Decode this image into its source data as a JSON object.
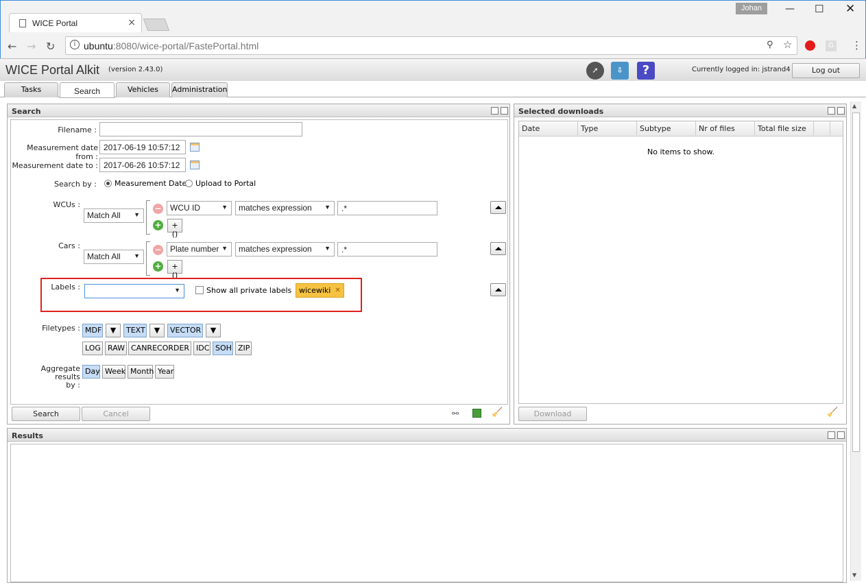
{
  "browser": {
    "tab_title": "WICE Portal",
    "user": "Johan",
    "url_host": "ubuntu",
    "url_rest": ":8080/wice-portal/FastePortal.html"
  },
  "app": {
    "title": "WICE Portal Alkit",
    "version": "(version 2.43.0)",
    "logged_in_text": "Currently logged in: jstrand4",
    "logout_label": "Log out",
    "tabs": [
      "Tasks",
      "Search",
      "Vehicles",
      "Administration"
    ],
    "selected_tab": "Search"
  },
  "search": {
    "header": "Search",
    "filename_label": "Filename :",
    "filename_value": "",
    "date_from_label": "Measurement date from :",
    "date_from_value": "2017-06-19 10:57:12",
    "date_to_label": "Measurement date to :",
    "date_to_value": "2017-06-26 10:57:12",
    "search_by_label": "Search by :",
    "search_by_options": [
      "Measurement Date",
      "Upload to Portal"
    ],
    "search_by_selected": "Measurement Date",
    "wcus": {
      "label": "WCUs :",
      "match": "Match All",
      "field": "WCU ID",
      "operator": "matches expression",
      "value": ".*",
      "group_label": "+()"
    },
    "cars": {
      "label": "Cars :",
      "match": "Match All",
      "field": "Plate number",
      "operator": "matches expression",
      "value": ".*",
      "group_label": "+()"
    },
    "labels": {
      "label": "Labels :",
      "select_value": "",
      "show_private_label": "Show all private labels",
      "chip": "wicewiki",
      "chip_close": "✕"
    },
    "filetypes": {
      "label": "Filetypes :",
      "row1": [
        "MDF",
        "TEXT",
        "VECTOR"
      ],
      "row2": [
        "LOG",
        "RAW",
        "CANRECORDER",
        "IDC",
        "SOH",
        "ZIP"
      ],
      "selected": [
        "MDF",
        "TEXT",
        "VECTOR",
        "SOH"
      ]
    },
    "aggregate": {
      "label_line1": "Aggregate results",
      "label_line2": "by :",
      "options": [
        "Day",
        "Week",
        "Month",
        "Year"
      ],
      "selected": "Day"
    },
    "search_button": "Search",
    "cancel_button": "Cancel"
  },
  "downloads": {
    "header": "Selected downloads",
    "columns": [
      "Date",
      "Type",
      "Subtype",
      "Nr of files",
      "Total file size"
    ],
    "empty_text": "No items to show.",
    "download_button": "Download"
  },
  "results": {
    "header": "Results"
  },
  "colors": {
    "highlight_border": "#e0201c",
    "chip_bg": "#f5c242",
    "toggle_on": "#c6dcf5"
  }
}
